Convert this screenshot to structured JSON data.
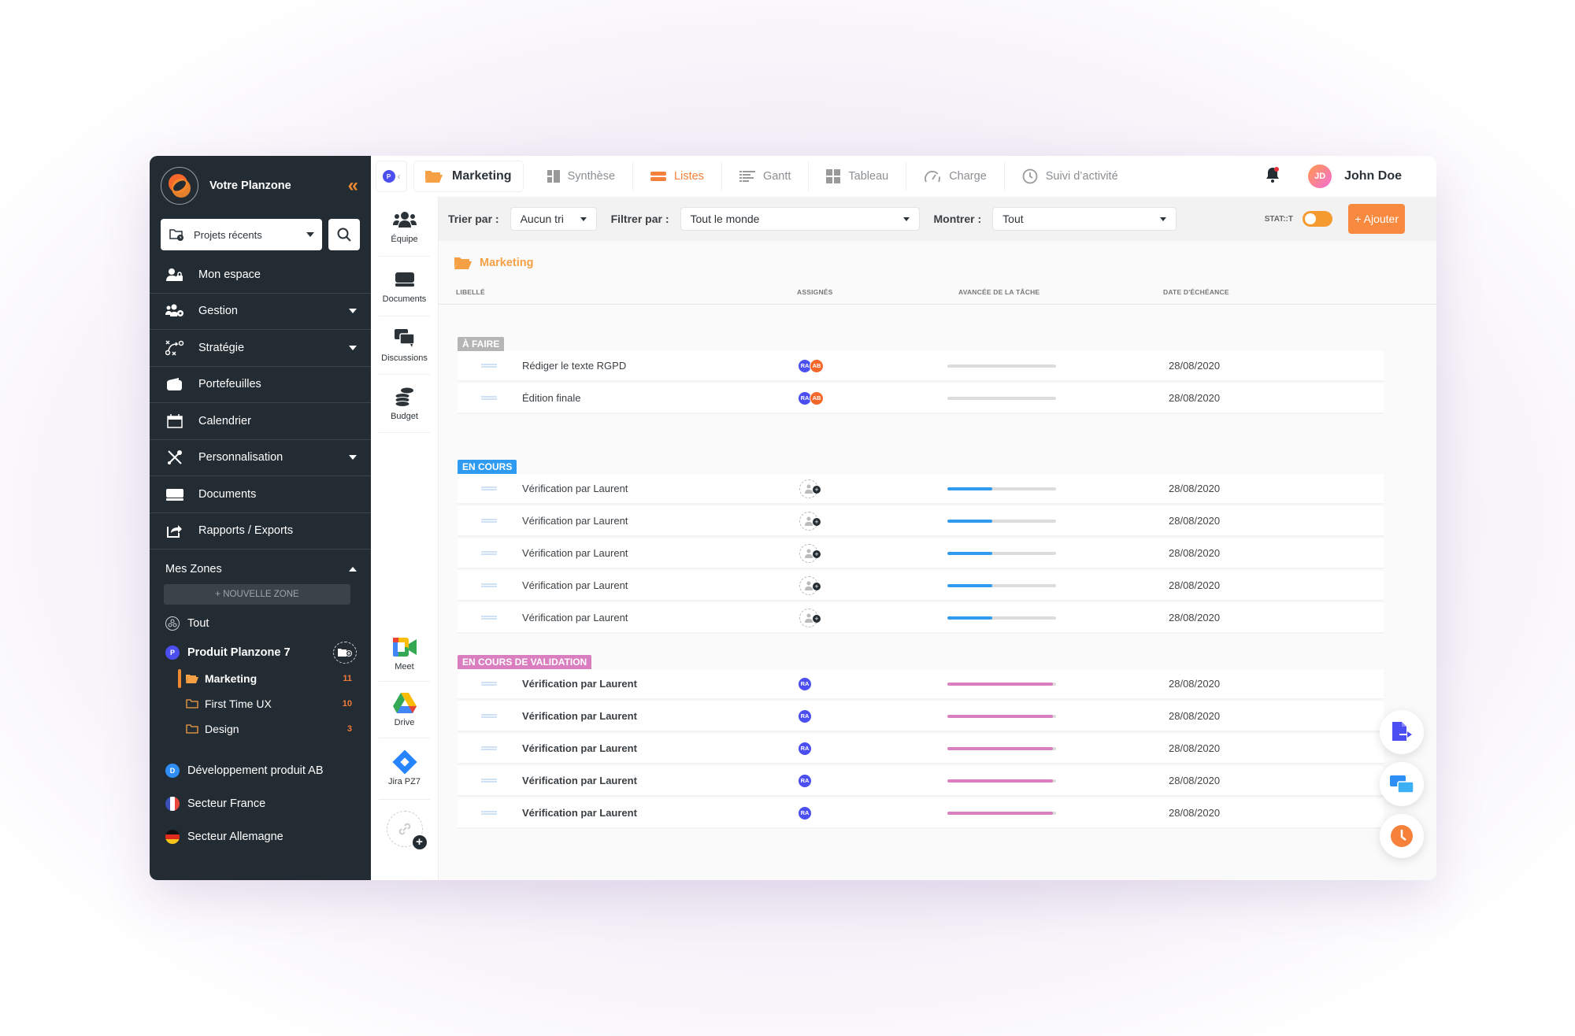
{
  "sidebar": {
    "brand": "Votre Planzone",
    "recent_select": "Projets récents",
    "nav": [
      {
        "label": "Mon espace",
        "icon": "user-lock-icon",
        "dropdown": false
      },
      {
        "label": "Gestion",
        "icon": "users-gear-icon",
        "dropdown": true
      },
      {
        "label": "Stratégie",
        "icon": "strategy-icon",
        "dropdown": true
      },
      {
        "label": "Portefeuilles",
        "icon": "wallet-icon",
        "dropdown": false
      },
      {
        "label": "Calendrier",
        "icon": "calendar-icon",
        "dropdown": false
      },
      {
        "label": "Personnalisation",
        "icon": "tools-icon",
        "dropdown": true
      },
      {
        "label": "Documents",
        "icon": "drive-icon",
        "dropdown": false
      },
      {
        "label": "Rapports / Exports",
        "icon": "export-icon",
        "dropdown": false
      }
    ],
    "zones_title": "Mes Zones",
    "new_zone": "+ NOUVELLE ZONE",
    "zones": {
      "all": "Tout",
      "product": {
        "label": "Produit Planzone 7",
        "initial": "P",
        "color": "#4b4ef0"
      },
      "subprojects": [
        {
          "label": "Marketing",
          "count": "11",
          "active": true
        },
        {
          "label": "First Time UX",
          "count": "10",
          "active": false
        },
        {
          "label": "Design",
          "count": "3",
          "active": false
        }
      ],
      "others": [
        {
          "label": "Développement produit AB",
          "initial": "D",
          "color": "#2f8ef5"
        },
        {
          "label": "Secteur France",
          "flag": "fr"
        },
        {
          "label": "Secteur Allemagne",
          "flag": "de"
        }
      ]
    }
  },
  "quickbar": {
    "top": [
      {
        "label": "Équipe",
        "icon": "team-icon"
      },
      {
        "label": "Documents",
        "icon": "drive-icon"
      },
      {
        "label": "Discussions",
        "icon": "chat-icon"
      },
      {
        "label": "Budget",
        "icon": "coins-icon"
      }
    ],
    "integrations": [
      {
        "label": "Meet",
        "icon": "google-meet-icon"
      },
      {
        "label": "Drive",
        "icon": "google-drive-icon"
      },
      {
        "label": "Jira PZ7",
        "icon": "jira-icon"
      }
    ]
  },
  "topbar": {
    "project_initial": "P",
    "current_project": "Marketing",
    "tabs": [
      {
        "label": "Synthèse",
        "active": false
      },
      {
        "label": "Listes",
        "active": true
      },
      {
        "label": "Gantt",
        "active": false
      },
      {
        "label": "Tableau",
        "active": false
      },
      {
        "label": "Charge",
        "active": false
      },
      {
        "label": "Suivi d’activité",
        "active": false
      }
    ],
    "user_initials": "JD",
    "user_name": "John Doe"
  },
  "filters": {
    "sort_label": "Trier par :",
    "sort_value": "Aucun tri",
    "filter_label": "Filtrer par :",
    "filter_value": "Tout le monde",
    "show_label": "Montrer :",
    "show_value": "Tout",
    "statut_label": "STAT::T",
    "add_button": "+ Ajouter"
  },
  "list": {
    "title": "Marketing",
    "columns": [
      "LIBELLÉ",
      "ASSIGNÉS",
      "AVANCÉE DE LA TÂCHE",
      "DATE D'ÉCHÉANCE"
    ],
    "groups": [
      {
        "label": "À FAIRE",
        "color": "#b5b5b5",
        "bar_color": "#9fcbf5",
        "tasks": [
          {
            "label": "Rédiger le texte RGPD",
            "assignees": [
              "RA",
              "AB"
            ],
            "progress": 0,
            "date": "28/08/2020"
          },
          {
            "label": "Édition finale",
            "assignees": [
              "RA",
              "AB"
            ],
            "progress": 0,
            "date": "28/08/2020"
          }
        ]
      },
      {
        "label": "EN COURS",
        "color": "#2f9bf0",
        "bar_color": "#2f9bf0",
        "tasks": [
          {
            "label": "Vérification par Laurent",
            "assignees": [],
            "progress": 0.41,
            "date": "28/08/2020"
          },
          {
            "label": "Vérification par Laurent",
            "assignees": [],
            "progress": 0.41,
            "date": "28/08/2020"
          },
          {
            "label": "Vérification par Laurent",
            "assignees": [],
            "progress": 0.41,
            "date": "28/08/2020"
          },
          {
            "label": "Vérification par Laurent",
            "assignees": [],
            "progress": 0.41,
            "date": "28/08/2020"
          },
          {
            "label": "Vérification par Laurent",
            "assignees": [],
            "progress": 0.41,
            "date": "28/08/2020"
          }
        ]
      },
      {
        "label": "EN COURS DE VALIDATION",
        "color": "#d97fbf",
        "bar_color": "#d97fbf",
        "tasks": [
          {
            "label": "Vérification par Laurent",
            "assignees": [
              "RA"
            ],
            "progress": 0.97,
            "date": "28/08/2020"
          },
          {
            "label": "Vérification par Laurent",
            "assignees": [
              "RA"
            ],
            "progress": 0.97,
            "date": "28/08/2020"
          },
          {
            "label": "Vérification par Laurent",
            "assignees": [
              "RA"
            ],
            "progress": 0.97,
            "date": "28/08/2020"
          },
          {
            "label": "Vérification par Laurent",
            "assignees": [
              "RA"
            ],
            "progress": 0.97,
            "date": "28/08/2020"
          },
          {
            "label": "Vérification par Laurent",
            "assignees": [
              "RA"
            ],
            "progress": 0.97,
            "date": "28/08/2020"
          }
        ]
      }
    ]
  },
  "avatar_colors": {
    "RA": "#4b4ef0",
    "AB": "#f5672a"
  },
  "fabs": [
    "export-document-icon",
    "screen-share-icon",
    "timer-icon"
  ]
}
